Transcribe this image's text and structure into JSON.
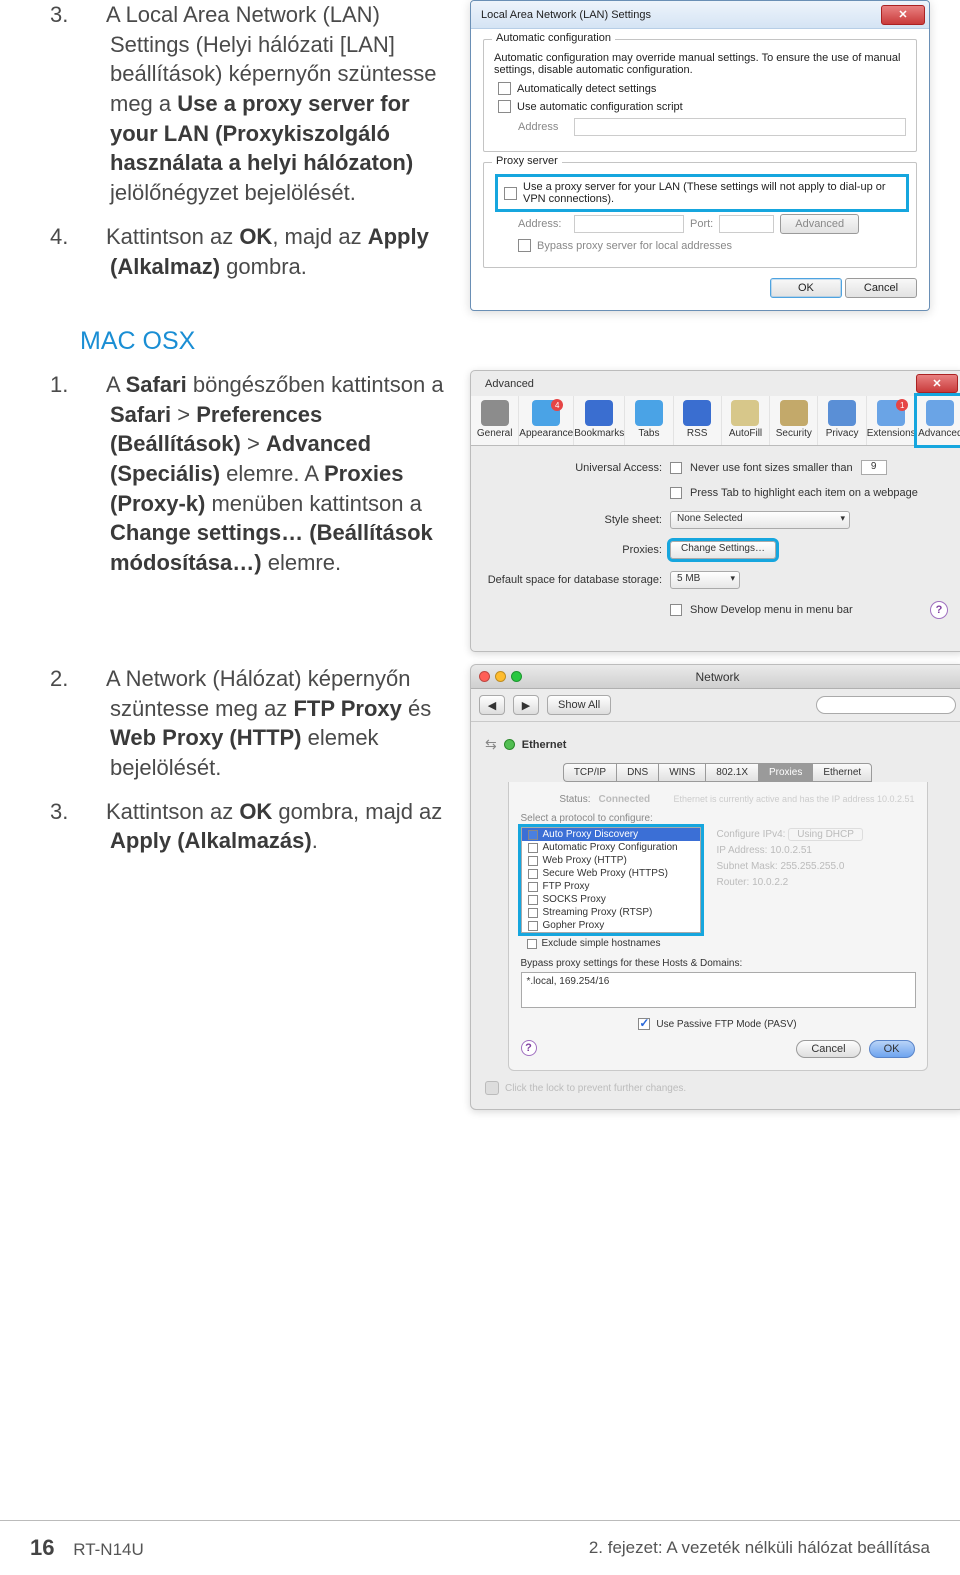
{
  "step3": {
    "num": "3.",
    "prefix": "A Local Area Network (LAN) Settings (Helyi hálózati [LAN] beállítások) képernyőn szüntesse meg a ",
    "bold1": "Use a proxy server for your LAN (Proxykiszolgáló használata a helyi hálózaton)",
    "suffix": " jelölőnégyzet bejelölését."
  },
  "step4": {
    "num": "4.",
    "prefix": "Kattintson az ",
    "bold1": "OK",
    "mid": ", majd az ",
    "bold2": "Apply (Alkalmaz)",
    "suffix": " gombra."
  },
  "macosx_heading": "MAC OSX",
  "mac_step1": {
    "num": "1.",
    "p1": "A ",
    "b1": "Safari",
    "p2": " böngészőben kattintson a ",
    "b2": "Safari",
    "p3": " > ",
    "b3": "Preferences (Beállítások)",
    "p4": " > ",
    "b4": "Advanced (Speciális)",
    "p5": " elemre. A ",
    "b5": "Proxies (Proxy-k)",
    "p6": " menüben kattintson a ",
    "b6": "Change settings… (Beállítások módosítása…)",
    "p7": " elemre."
  },
  "mac_step2": {
    "num": "2.",
    "p1": "A Network (Hálózat) képernyőn szüntesse meg az ",
    "b1": "FTP Proxy",
    "p2": " és ",
    "b2": "Web Proxy (HTTP)",
    "p3": " elemek bejelölését."
  },
  "mac_step3": {
    "num": "3.",
    "p1": "Kattintson az ",
    "b1": "OK",
    "p2": " gombra, majd az ",
    "b2": "Apply (Alkalmazás)",
    "p3": "."
  },
  "win": {
    "title": "Local Area Network (LAN) Settings",
    "grp_auto": "Automatic configuration",
    "auto_desc": "Automatic configuration may override manual settings. To ensure the use of manual settings, disable automatic configuration.",
    "cb_autodetect": "Automatically detect settings",
    "cb_autoscript": "Use automatic configuration script",
    "lbl_address": "Address",
    "grp_proxy": "Proxy server",
    "cb_useproxy": "Use a proxy server for your LAN (These settings will not apply to dial-up or VPN connections).",
    "lbl_addr2": "Address:",
    "lbl_port": "Port:",
    "btn_adv": "Advanced",
    "cb_bypass": "Bypass proxy server for local addresses",
    "btn_ok": "OK",
    "btn_cancel": "Cancel"
  },
  "adv": {
    "title": "Advanced",
    "tabs": [
      "General",
      "Appearance",
      "Bookmarks",
      "Tabs",
      "RSS",
      "AutoFill",
      "Security",
      "Privacy",
      "Extensions",
      "Advanced"
    ],
    "badge_idx": {
      "1": "4",
      "8": "1"
    },
    "row_ua_lab": "Universal Access:",
    "row_ua_txt": "Never use font sizes smaller than",
    "row_ua_val": "9",
    "row_tab_txt": "Press Tab to highlight each item on a webpage",
    "row_ss_lab": "Style sheet:",
    "row_ss_val": "None Selected",
    "row_px_lab": "Proxies:",
    "row_px_btn": "Change Settings…",
    "row_db_lab": "Default space for database storage:",
    "row_db_val": "5 MB",
    "row_dev_txt": "Show Develop menu in menu bar"
  },
  "net": {
    "title": "Network",
    "showall": "Show All",
    "eth": "Ethernet",
    "tabs": [
      "TCP/IP",
      "DNS",
      "WINS",
      "802.1X",
      "Proxies",
      "Ethernet"
    ],
    "sel_label": "Select a protocol to configure:",
    "status_lab": "Status:",
    "status_val": "Connected",
    "protos": [
      "Auto Proxy Discovery",
      "Automatic Proxy Configuration",
      "Web Proxy (HTTP)",
      "Secure Web Proxy (HTTPS)",
      "FTP Proxy",
      "SOCKS Proxy",
      "Streaming Proxy (RTSP)",
      "Gopher Proxy"
    ],
    "exclude": "Exclude simple hostnames",
    "bypass_lab": "Bypass proxy settings for these Hosts & Domains:",
    "bypass_val": "*.local, 169.254/16",
    "pasv": "Use Passive FTP Mode (PASV)",
    "cancel": "Cancel",
    "ok": "OK",
    "faded_note": "Ethernet is currently active and has the IP address 10.0.2.51",
    "f_ipv4": "Configure IPv4:",
    "f_ipv4_v": "Using DHCP",
    "f_ip": "IP Address:",
    "f_ip_v": "10.0.2.51",
    "f_mask": "Subnet Mask:",
    "f_mask_v": "255.255.255.0",
    "f_router": "Router:",
    "f_router_v": "10.0.2.2",
    "lock_txt": "Click the lock to prevent further changes."
  },
  "footer": {
    "page": "16",
    "model": "RT-N14U",
    "chapter": "2. fejezet: A vezeték nélküli hálózat beállítása"
  },
  "icons": {
    "general": "#8c8c8c",
    "appearance": "#4aa3e6",
    "bookmarks": "#3a6ed0",
    "tabs": "#4aa3e6",
    "rss": "#3a6ed0",
    "autofill": "#d7c78a",
    "security": "#c3a96a",
    "privacy": "#5a8fd6",
    "extensions": "#6aa4e6",
    "advanced": "#6aa4e6"
  }
}
